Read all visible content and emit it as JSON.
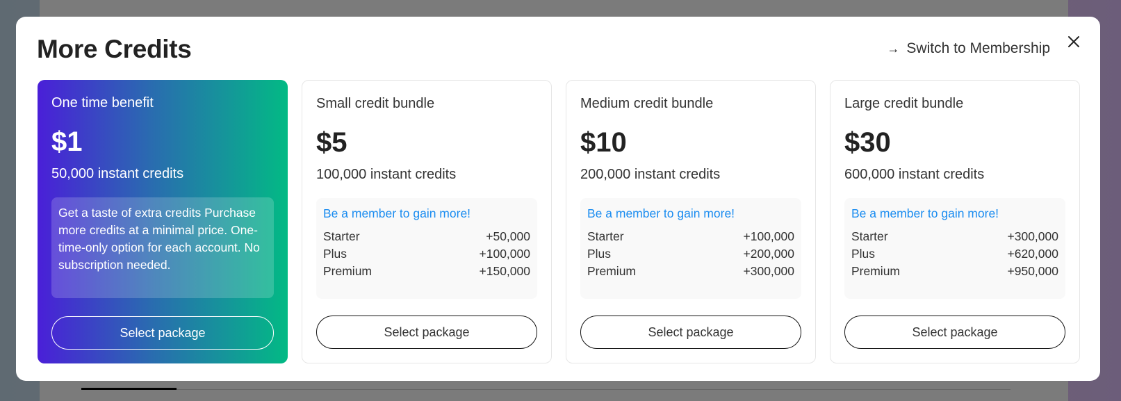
{
  "modal": {
    "title": "More Credits",
    "switch_label": "Switch to Membership",
    "switch_icon": "arrow-right-icon",
    "close_icon": "close-icon"
  },
  "colors": {
    "promo_gradient_start": "#4a1fd8",
    "promo_gradient_end": "#02ba84",
    "hint_blue": "#1a8cf0"
  },
  "cards": [
    {
      "name": "One time benefit",
      "price": "$1",
      "credits": "50,000 instant credits",
      "description": "Get a taste of extra credits Purchase more credits at a minimal price. One-time-only option for each account. No subscription needed.",
      "button": "Select package"
    },
    {
      "name": "Small credit bundle",
      "price": "$5",
      "credits": "100,000 instant credits",
      "hint": "Be a member to gain more!",
      "tiers": [
        {
          "label": "Starter",
          "value": "+50,000"
        },
        {
          "label": "Plus",
          "value": "+100,000"
        },
        {
          "label": "Premium",
          "value": "+150,000"
        }
      ],
      "button": "Select package"
    },
    {
      "name": "Medium credit bundle",
      "price": "$10",
      "credits": "200,000 instant credits",
      "hint": "Be a member to gain more!",
      "tiers": [
        {
          "label": "Starter",
          "value": "+100,000"
        },
        {
          "label": "Plus",
          "value": "+200,000"
        },
        {
          "label": "Premium",
          "value": "+300,000"
        }
      ],
      "button": "Select package"
    },
    {
      "name": "Large credit bundle",
      "price": "$30",
      "credits": "600,000 instant credits",
      "hint": "Be a member to gain more!",
      "tiers": [
        {
          "label": "Starter",
          "value": "+300,000"
        },
        {
          "label": "Plus",
          "value": "+620,000"
        },
        {
          "label": "Premium",
          "value": "+950,000"
        }
      ],
      "button": "Select package"
    }
  ]
}
